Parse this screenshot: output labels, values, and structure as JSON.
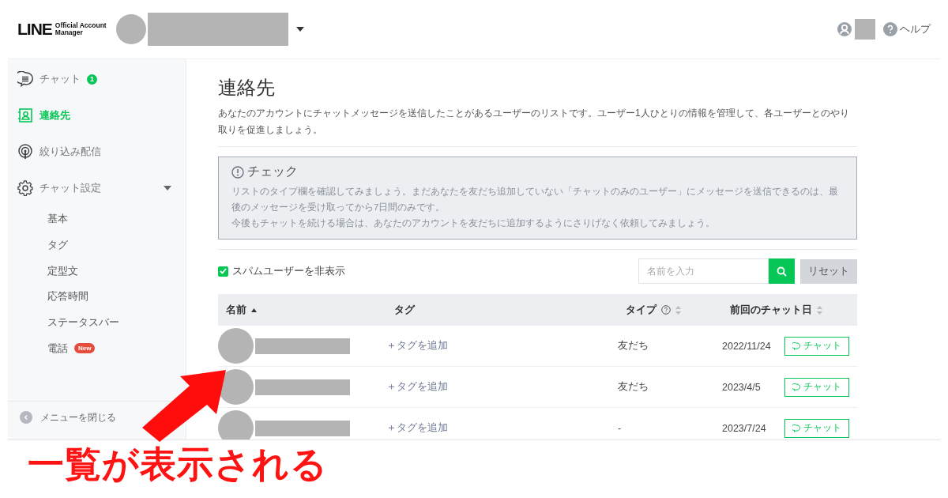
{
  "header": {
    "logo": {
      "brand": "LINE",
      "line1": "Official Account",
      "line2": "Manager"
    },
    "help": "ヘルプ"
  },
  "sidebar": {
    "items": [
      {
        "kind": "chat",
        "label": "チャット",
        "badge": "1",
        "selected": false
      },
      {
        "kind": "contacts",
        "label": "連絡先",
        "selected": true
      },
      {
        "kind": "broadcast",
        "label": "絞り込み配信",
        "selected": false
      },
      {
        "kind": "settings",
        "label": "チャット設定",
        "selected": false,
        "expanded": true,
        "children": [
          {
            "label": "基本"
          },
          {
            "label": "タグ"
          },
          {
            "label": "定型文"
          },
          {
            "label": "応答時間"
          },
          {
            "label": "ステータスバー"
          },
          {
            "label": "電話",
            "tag": "New"
          }
        ]
      }
    ],
    "collapse": "メニューを閉じる"
  },
  "page": {
    "title": "連絡先",
    "description": "あなたのアカウントにチャットメッセージを送信したことがあるユーザーのリストです。ユーザー1人ひとりの情報を管理して、各ユーザーとのやり取りを促進しましょう。",
    "notice": {
      "title": "チェック",
      "lines": [
        "リストのタイプ欄を確認してみましょう。まだあなたを友だち追加していない「チャットのみのユーザー」にメッセージを送信できるのは、最後のメッセージを受け取ってから7日間のみです。",
        "今後もチャットを続ける場合は、あなたのアカウントを友だちに追加するようにさりげなく依頼してみましょう。"
      ]
    },
    "spam_filter": {
      "label": "スパムユーザーを非表示",
      "checked": true
    },
    "search": {
      "placeholder": "名前を入力"
    },
    "reset_button": "リセット",
    "table": {
      "columns": [
        {
          "label": "名前",
          "sorted_ascending": true,
          "sortable": true
        },
        {
          "label": "タグ",
          "sortable": false
        },
        {
          "label": "タイプ",
          "help": true,
          "sortable": true
        },
        {
          "label": "前回のチャット日",
          "sortable": true
        }
      ],
      "rows": [
        {
          "tag_action": "＋タグを追加",
          "type": "友だち",
          "last_chat": "2022/11/24",
          "button": "チャット"
        },
        {
          "tag_action": "＋タグを追加",
          "type": "友だち",
          "last_chat": "2023/4/5",
          "button": "チャット"
        },
        {
          "tag_action": "＋タグを追加",
          "type": "-",
          "last_chat": "2023/7/24",
          "button": "チャット"
        }
      ]
    }
  },
  "annotation": {
    "text": "一覧が表示される"
  }
}
